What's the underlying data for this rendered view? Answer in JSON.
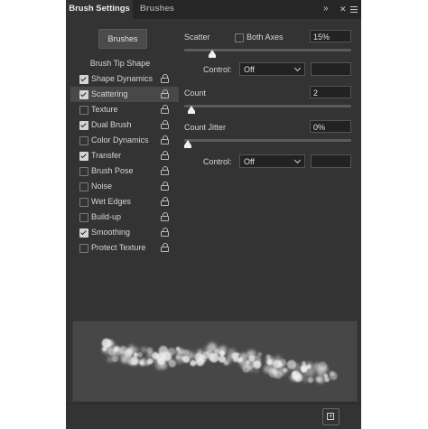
{
  "tabs": {
    "active": "Brush Settings",
    "inactive": "Brushes"
  },
  "header_controls": {
    "collapse": "»",
    "close": "✕",
    "menu_icon": "hamburger-menu-icon"
  },
  "brushes_button": "Brushes",
  "options": {
    "header": "Brush Tip Shape",
    "items": [
      {
        "label": "Shape Dynamics",
        "checked": true
      },
      {
        "label": "Scattering",
        "checked": true,
        "selected": true
      },
      {
        "label": "Texture",
        "checked": false
      },
      {
        "label": "Dual Brush",
        "checked": true
      },
      {
        "label": "Color Dynamics",
        "checked": false
      },
      {
        "label": "Transfer",
        "checked": true
      },
      {
        "label": "Brush Pose",
        "checked": false
      },
      {
        "label": "Noise",
        "checked": false
      },
      {
        "label": "Wet Edges",
        "checked": false
      },
      {
        "label": "Build-up",
        "checked": false
      },
      {
        "label": "Smoothing",
        "checked": true
      },
      {
        "label": "Protect Texture",
        "checked": false
      }
    ]
  },
  "scatter": {
    "label": "Scatter",
    "both_axes_label": "Both Axes",
    "both_axes_checked": false,
    "value": "15%",
    "slider_fraction": 0.15,
    "control_label": "Control:",
    "control_value": "Off"
  },
  "count": {
    "label": "Count",
    "value": "2",
    "slider_fraction": 0.02
  },
  "count_jitter": {
    "label": "Count Jitter",
    "value": "0%",
    "slider_fraction": 0.0,
    "control_label": "Control:",
    "control_value": "Off"
  },
  "footer": {
    "new_preset_icon": "new-preset-icon"
  }
}
